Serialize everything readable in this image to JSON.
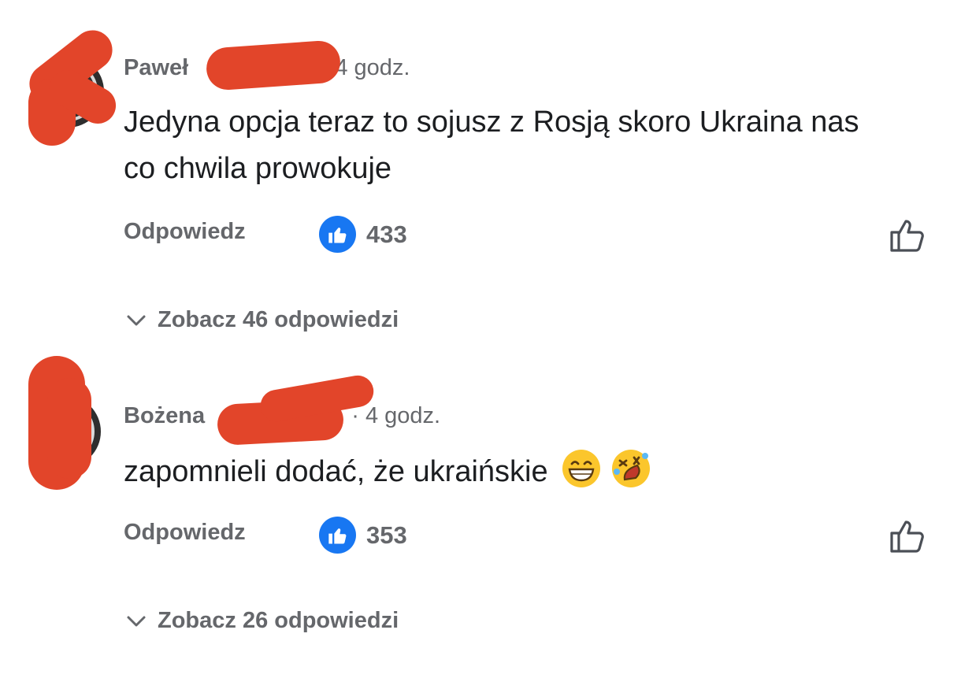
{
  "comments": [
    {
      "author_visible": "Paweł",
      "time": "4 godz.",
      "text": "Jedyna opcja teraz to sojusz z Rosją skoro Ukraina nas co chwila prowokuje",
      "reply_label": "Odpowiedz",
      "likes": "433",
      "view_replies": "Zobacz 46 odpowiedzi"
    },
    {
      "author_visible": "Bożena",
      "time": "· 4 godz.",
      "text": "zapomnieli dodać, że ukraińskie",
      "emoji": [
        "grinning-face-with-smiling-eyes",
        "rolling-on-floor-laughing"
      ],
      "reply_label": "Odpowiedz",
      "likes": "353",
      "view_replies": "Zobacz 26 odpowiedzi"
    }
  ],
  "colors": {
    "accent": "#1877f2",
    "muted_text": "#65676b",
    "body_text": "#1c1e21",
    "redaction": "#e2452a"
  }
}
